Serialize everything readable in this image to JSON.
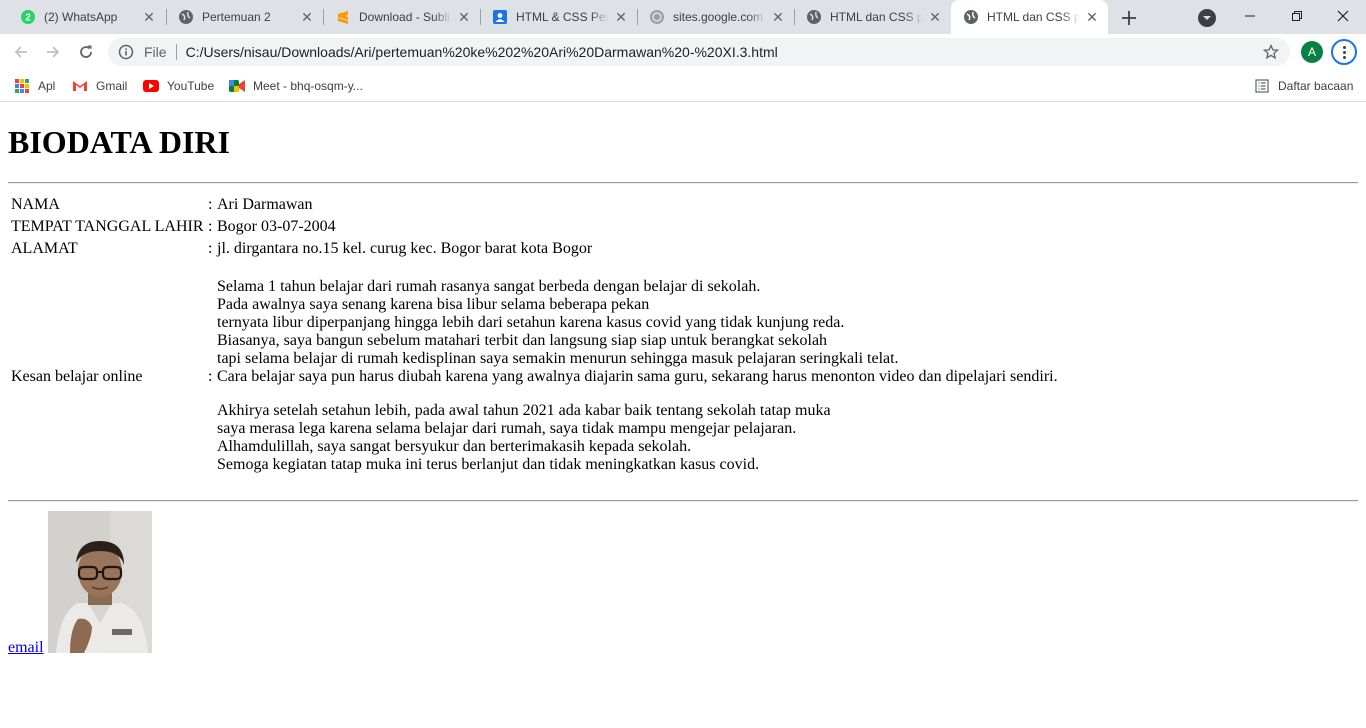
{
  "browser": {
    "tabs": [
      {
        "title": "(2) WhatsApp",
        "icon": "whatsapp-icon",
        "badge": "2"
      },
      {
        "title": "Pertemuan 2",
        "icon": "globe-icon"
      },
      {
        "title": "Download - Subli",
        "icon": "sublime-icon"
      },
      {
        "title": "HTML & CSS Pert",
        "icon": "classroom-icon"
      },
      {
        "title": "sites.google.com",
        "icon": "sites-icon"
      },
      {
        "title": "HTML dan CSS pe",
        "icon": "globe-icon"
      },
      {
        "title": "HTML dan CSS p",
        "icon": "globe-icon",
        "active": true
      }
    ],
    "scheme_label": "File",
    "url": "C:/Users/nisau/Downloads/Ari/pertemuan%20ke%202%20Ari%20Darmawan%20-%20XI.3.html",
    "profile_initial": "A",
    "bookmarks": [
      {
        "label": "Apl",
        "icon": "apps-grid-icon"
      },
      {
        "label": "Gmail",
        "icon": "gmail-icon"
      },
      {
        "label": "YouTube",
        "icon": "youtube-icon"
      },
      {
        "label": "Meet - bhq-osqm-y...",
        "icon": "meet-icon"
      }
    ],
    "reading_list_label": "Daftar bacaan",
    "colors": {
      "tabstrip": "#dee1e6",
      "omnibox": "#f1f3f4",
      "avatar": "#0b8043",
      "accent": "#1a73e8"
    }
  },
  "page": {
    "title": "BIODATA DIRI",
    "separator": ":",
    "rows": [
      {
        "label": "NAMA",
        "value": "Ari Darmawan"
      },
      {
        "label": "TEMPAT TANGGAL LAHIR",
        "value": "Bogor 03-07-2004"
      },
      {
        "label": "ALAMAT",
        "value": "jl. dirgantara no.15 kel. curug kec. Bogor barat kota Bogor"
      }
    ],
    "impression_label": "Kesan belajar online",
    "impression_lines_before": [
      "Selama 1 tahun belajar dari rumah rasanya sangat berbeda dengan belajar di sekolah.",
      "Pada awalnya saya senang karena bisa libur selama beberapa pekan",
      "ternyata libur diperpanjang hingga lebih dari setahun karena kasus covid yang tidak kunjung reda.",
      "Biasanya, saya bangun sebelum matahari terbit dan langsung siap siap untuk berangkat sekolah",
      "tapi selama belajar di rumah kedisplinan saya semakin menurun sehingga masuk pelajaran seringkali telat."
    ],
    "impression_line_main": "Cara belajar saya pun harus diubah karena yang awalnya diajarin sama guru, sekarang harus menonton video dan dipelajari sendiri.",
    "impression_lines_after": [
      "Akhirya setelah setahun lebih, pada awal tahun 2021 ada kabar baik tentang sekolah tatap muka",
      "saya merasa lega karena selama belajar dari rumah, saya tidak mampu mengejar pelajaran.",
      "Alhamdulillah, saya sangat bersyukur dan berterimakasih kepada sekolah.",
      "Semoga kegiatan tatap muka ini terus berlanjut dan tidak meningkatkan kasus covid."
    ],
    "email_link": "email"
  }
}
